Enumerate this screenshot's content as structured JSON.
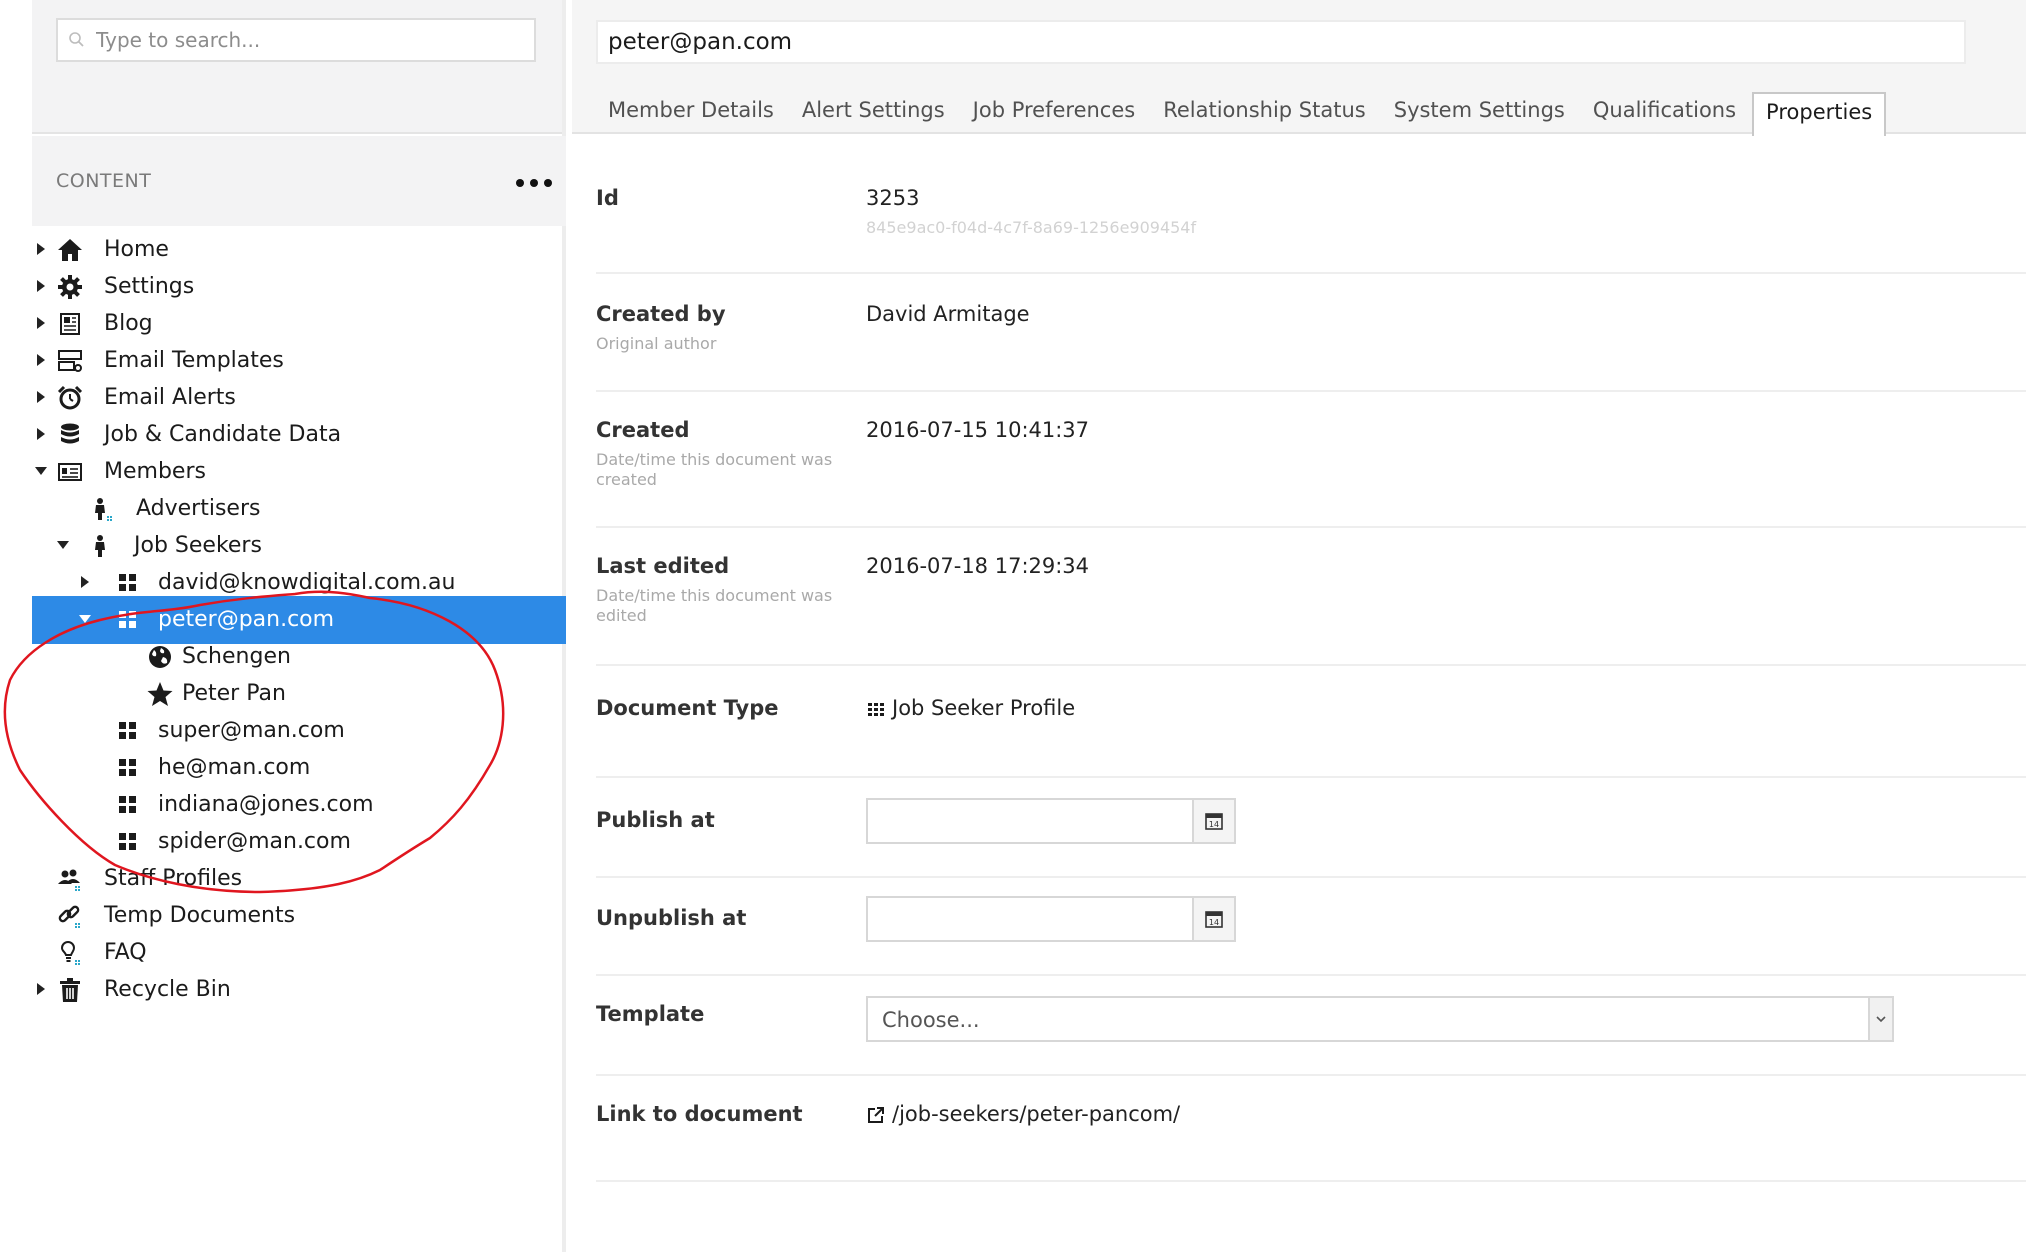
{
  "sidebar": {
    "search_placeholder": "Type to search...",
    "section_label": "CONTENT",
    "items": {
      "home": "Home",
      "settings": "Settings",
      "blog": "Blog",
      "email_templates": "Email Templates",
      "email_alerts": "Email Alerts",
      "job_candidate_data": "Job & Candidate Data",
      "members": "Members",
      "advertisers": "Advertisers",
      "job_seekers": "Job Seekers",
      "david": "david@knowdigital.com.au",
      "peter": "peter@pan.com",
      "schengen": "Schengen",
      "peter_pan": "Peter Pan",
      "super": "super@man.com",
      "he": "he@man.com",
      "indiana": "indiana@jones.com",
      "spider": "spider@man.com",
      "staff_profiles": "Staff Profiles",
      "temp_documents": "Temp Documents",
      "faq": "FAQ",
      "recycle_bin": "Recycle Bin"
    },
    "selected_color": "#2d8ae6"
  },
  "main": {
    "title_value": "peter@pan.com",
    "tabs": {
      "member_details": "Member Details",
      "alert_settings": "Alert Settings",
      "job_preferences": "Job Preferences",
      "relationship_status": "Relationship Status",
      "system_settings": "System Settings",
      "qualifications": "Qualifications",
      "properties": "Properties"
    },
    "props": {
      "id_label": "Id",
      "id_value": "3253",
      "guid_value": "845e9ac0-f04d-4c7f-8a69-1256e909454f",
      "created_by_label": "Created by",
      "created_by_desc": "Original author",
      "created_by_value": "David Armitage",
      "created_label": "Created",
      "created_desc": "Date/time this document was created",
      "created_value": "2016-07-15 10:41:37",
      "last_edited_label": "Last edited",
      "last_edited_desc": "Date/time this document was edited",
      "last_edited_value": "2016-07-18 17:29:34",
      "doc_type_label": "Document Type",
      "doc_type_value": "Job Seeker Profile",
      "publish_label": "Publish at",
      "publish_value": "",
      "unpublish_label": "Unpublish at",
      "unpublish_value": "",
      "template_label": "Template",
      "template_value": "Choose...",
      "link_label": "Link to document",
      "link_value": "/job-seekers/peter-pancom/",
      "calendar_day": "14"
    }
  },
  "annotation_color": "#e0161f"
}
